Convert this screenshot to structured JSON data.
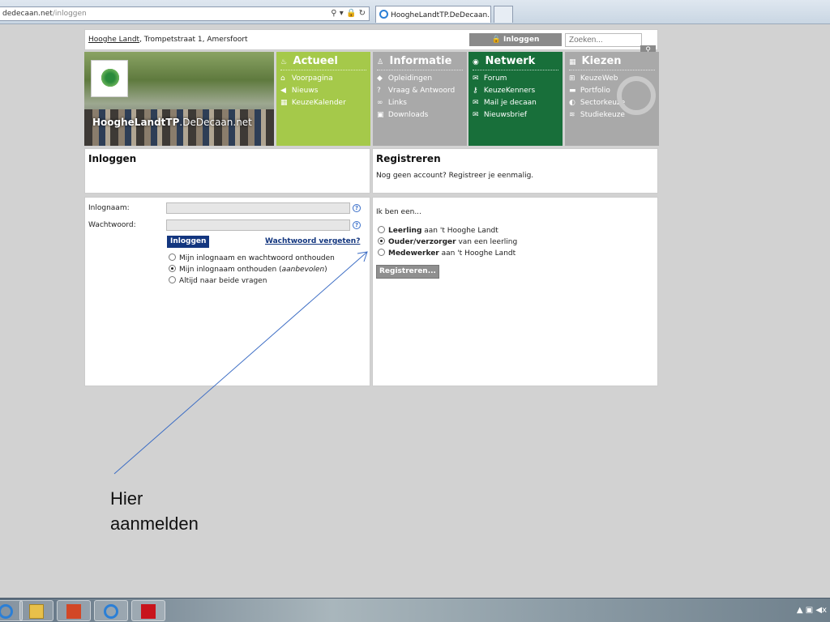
{
  "browser": {
    "address_domain": "dedecaan.net",
    "address_path": "/inloggen",
    "tab_title": "HoogheLandtTP.DeDecaan....",
    "tab_close": "✕"
  },
  "site": {
    "school_link": "Hooghe Landt",
    "address": ", Trompetstraat 1, Amersfoort",
    "login_button": "Inloggen",
    "search_placeholder": "Zoeken...",
    "brand_bold": "HoogheLandtTP",
    "brand_rest": ".DeDecaan.net"
  },
  "nav": {
    "actueel": {
      "title": "Actueel",
      "items": [
        "Voorpagina",
        "Nieuws",
        "KeuzeKalender"
      ]
    },
    "informatie": {
      "title": "Informatie",
      "items": [
        "Opleidingen",
        "Vraag & Antwoord",
        "Links",
        "Downloads"
      ]
    },
    "netwerk": {
      "title": "Netwerk",
      "items": [
        "Forum",
        "KeuzeKenners",
        "Mail je decaan",
        "Nieuwsbrief"
      ]
    },
    "kiezen": {
      "title": "Kiezen",
      "items": [
        "KeuzeWeb",
        "Portfolio",
        "Sectorkeuze",
        "Studiekeuze"
      ]
    }
  },
  "login": {
    "heading": "Inloggen",
    "username_label": "Inlognaam:",
    "password_label": "Wachtwoord:",
    "submit": "Inloggen",
    "forgot": "Wachtwoord vergeten?",
    "options": [
      {
        "label": "Mijn inlognaam en wachtwoord onthouden",
        "selected": false
      },
      {
        "label": "Mijn inlognaam onthouden (",
        "emph": "aanbevolen",
        "tail": ")",
        "selected": true
      },
      {
        "label": "Altijd naar beide vragen",
        "selected": false
      }
    ]
  },
  "register": {
    "heading": "Registreren",
    "text": "Nog geen account? Registreer je eenmalig.",
    "prompt": "Ik ben een...",
    "roles": [
      {
        "bold": "Leerling",
        "rest": " aan 't Hooghe Landt",
        "selected": false
      },
      {
        "bold": "Ouder/verzorger",
        "rest": " van een leerling",
        "selected": true
      },
      {
        "bold": "Medewerker",
        "rest": " aan 't Hooghe Landt",
        "selected": false
      }
    ],
    "submit": "Registreren..."
  },
  "annotation": {
    "line1": "Hier",
    "line2": "aanmelden"
  },
  "icons": {
    "search": "search-icon",
    "lock": "lock-icon",
    "refresh": "refresh-icon",
    "help": "help-icon",
    "arrow": "annotation-arrow-icon"
  }
}
